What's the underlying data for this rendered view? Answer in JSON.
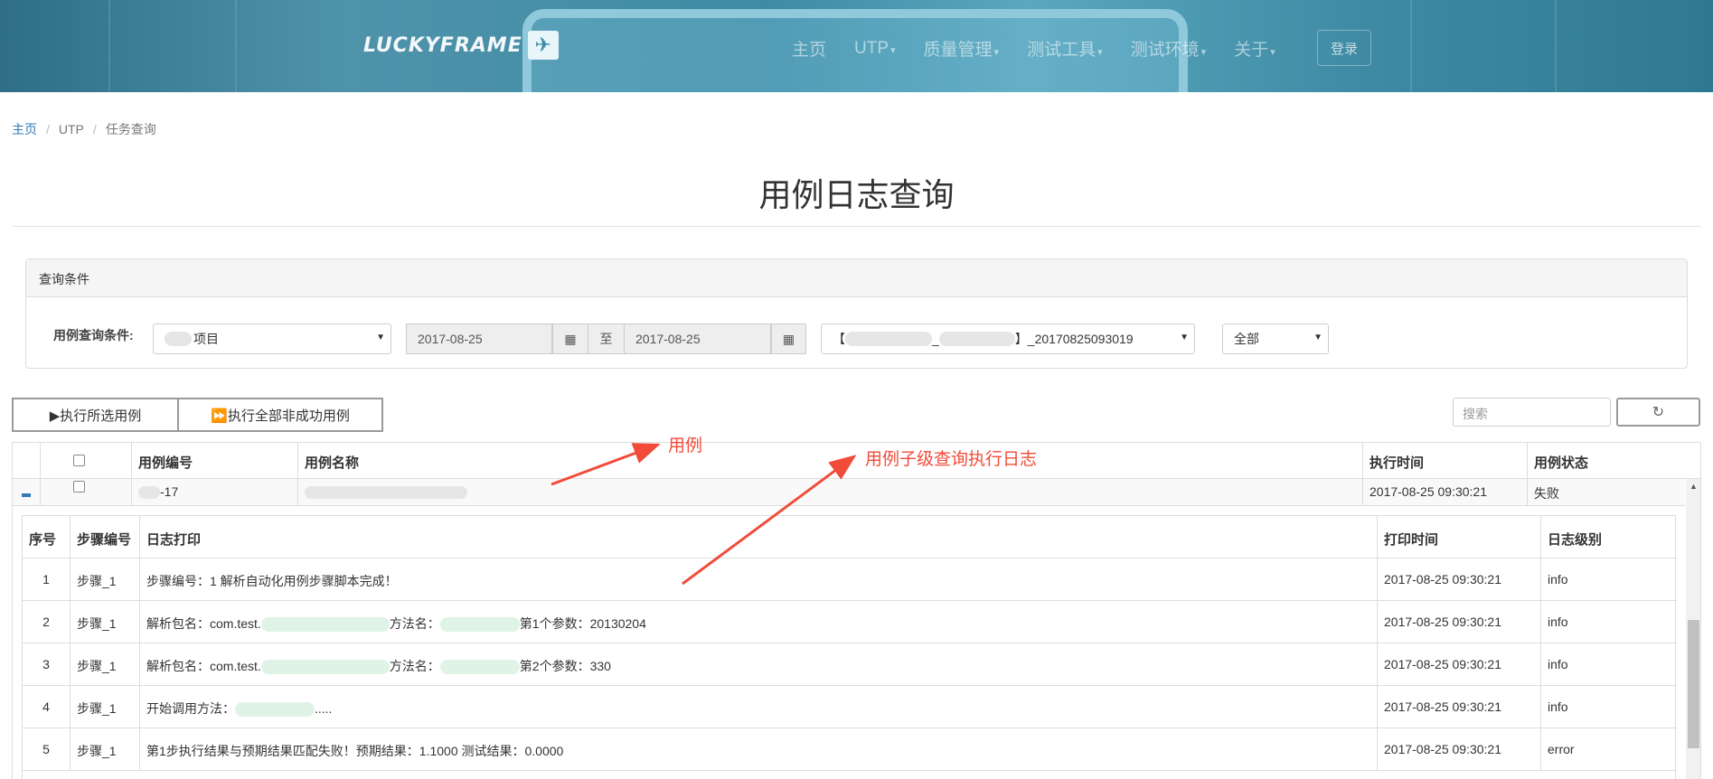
{
  "header": {
    "logo_text": "LUCKYFRAME",
    "nav": [
      "主页",
      "UTP",
      "质量管理",
      "测试工具",
      "测试环境",
      "关于"
    ],
    "login": "登录"
  },
  "breadcrumb": [
    "主页",
    "UTP",
    "任务查询"
  ],
  "page_title": "用例日志查询",
  "query": {
    "panel_title": "查询条件",
    "label": "用例查询条件:",
    "project_select": "项目",
    "date_from": "2017-08-25",
    "date_sep": "至",
    "date_to": "2017-08-25",
    "task_select_prefix": "【",
    "task_select_mid": "_",
    "task_select_suffix": "】_20170825093019",
    "status_select": "全部"
  },
  "actions": {
    "run_selected": "▶执行所选用例",
    "run_failed": "⏩执行全部非成功用例",
    "search_placeholder": "搜索"
  },
  "table": {
    "headers": [
      "用例编号",
      "用例名称",
      "执行时间",
      "用例状态"
    ],
    "row": {
      "case_id": "-17",
      "exec_time": "2017-08-25 09:30:21",
      "status": "失败"
    }
  },
  "log_table": {
    "headers": [
      "序号",
      "步骤编号",
      "日志打印",
      "打印时间",
      "日志级别"
    ],
    "rows": [
      {
        "no": "1",
        "step": "步骤_1",
        "msg_a": "步骤编号：1 解析自动化用例步骤脚本完成！",
        "msg_b": "",
        "msg_c": "",
        "time": "2017-08-25 09:30:21",
        "level": "info"
      },
      {
        "no": "2",
        "step": "步骤_1",
        "msg_a": "解析包名：com.test.",
        "msg_b": "方法名：",
        "msg_c": "第1个参数：20130204",
        "time": "2017-08-25 09:30:21",
        "level": "info"
      },
      {
        "no": "3",
        "step": "步骤_1",
        "msg_a": "解析包名：com.test.",
        "msg_b": "方法名：",
        "msg_c": "第2个参数：330",
        "time": "2017-08-25 09:30:21",
        "level": "info"
      },
      {
        "no": "4",
        "step": "步骤_1",
        "msg_a": "开始调用方法：",
        "msg_b": "",
        "msg_c": ".....",
        "time": "2017-08-25 09:30:21",
        "level": "info"
      },
      {
        "no": "5",
        "step": "步骤_1",
        "msg_a": "第1步执行结果与预期结果匹配失败！预期结果：1.1000 测试结果：0.0000",
        "msg_b": "",
        "msg_c": "",
        "time": "2017-08-25 09:30:21",
        "level": "error"
      }
    ]
  },
  "annotations": {
    "case": "用例",
    "child": "用例子级查询执行日志"
  },
  "colors": {
    "link": "#337ab7",
    "info": "#1aa34a",
    "error": "#e8191a",
    "annotation": "#f24b3a"
  }
}
